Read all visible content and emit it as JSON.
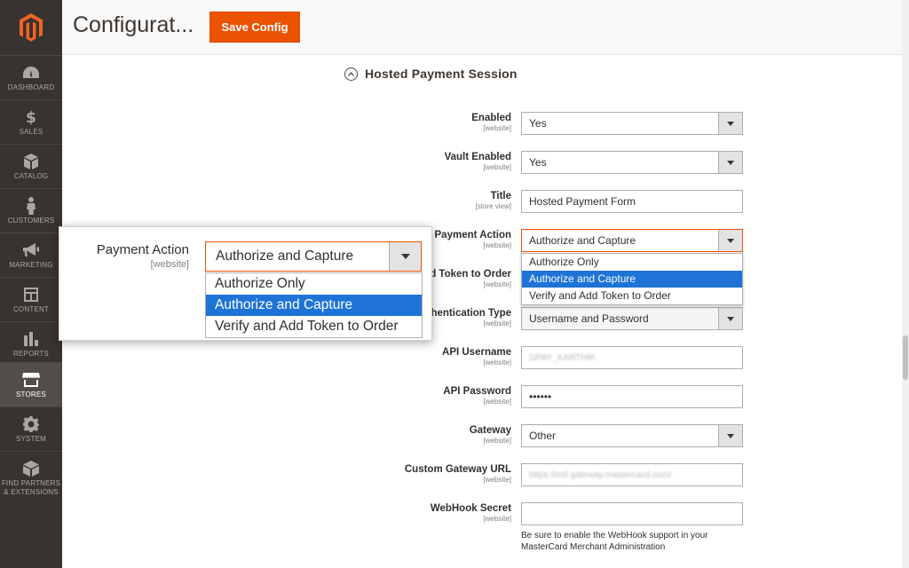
{
  "sidebar": {
    "logo": "magento-logo",
    "items": [
      {
        "label": "DASHBOARD",
        "icon": "dashboard-icon"
      },
      {
        "label": "SALES",
        "icon": "dollar-icon"
      },
      {
        "label": "CATALOG",
        "icon": "box-icon"
      },
      {
        "label": "CUSTOMERS",
        "icon": "person-icon"
      },
      {
        "label": "MARKETING",
        "icon": "megaphone-icon"
      },
      {
        "label": "CONTENT",
        "icon": "layout-icon"
      },
      {
        "label": "REPORTS",
        "icon": "bar-chart-icon"
      },
      {
        "label": "STORES",
        "icon": "store-icon",
        "active": true
      },
      {
        "label": "SYSTEM",
        "icon": "gear-icon"
      },
      {
        "label": "FIND PARTNERS",
        "label2": "& EXTENSIONS",
        "icon": "cube-icon"
      }
    ]
  },
  "header": {
    "title": "Configurat...",
    "save_label": "Save Config"
  },
  "section": {
    "title": "Hosted Payment Session"
  },
  "fields": {
    "enabled": {
      "label": "Enabled",
      "scope": "[website]",
      "value": "Yes"
    },
    "vault_enabled": {
      "label": "Vault Enabled",
      "scope": "[website]",
      "value": "Yes"
    },
    "title": {
      "label": "Title",
      "scope": "[store view]",
      "value": "Hosted Payment Form"
    },
    "payment_action": {
      "label": "Payment Action",
      "scope": "[website]",
      "value": "Authorize and Capture"
    },
    "verify_token": {
      "label": "d Token to Order",
      "scope": "[website]"
    },
    "auth_type": {
      "label": "uthentication Type",
      "scope": "[website]",
      "value": "Username and Password"
    },
    "api_username": {
      "label": "API Username",
      "scope": "[website]",
      "value": "GPAY_KARTHIK"
    },
    "api_password": {
      "label": "API Password",
      "scope": "[website]",
      "value": "••••••"
    },
    "gateway": {
      "label": "Gateway",
      "scope": "[website]",
      "value": "Other"
    },
    "custom_gateway_url": {
      "label": "Custom Gateway URL",
      "scope": "[website]",
      "value": "https://mtf.gateway.mastercard.com/"
    },
    "webhook_secret": {
      "label": "WebHook Secret",
      "scope": "[website]",
      "value": "",
      "note": "Be sure to enable the WebHook support in your MasterCard Merchant Administration"
    }
  },
  "payment_action_options": [
    "Authorize Only",
    "Authorize and Capture",
    "Verify and Add Token to Order"
  ],
  "payment_action_selected": "Authorize and Capture",
  "callout": {
    "label": "Payment Action",
    "scope": "[website]",
    "value": "Authorize and Capture",
    "options": [
      "Authorize Only",
      "Authorize and Capture",
      "Verify and Add Token to Order"
    ]
  },
  "colors": {
    "accent": "#eb5202",
    "sidebar_bg": "#373330",
    "selection": "#1e73d6"
  }
}
